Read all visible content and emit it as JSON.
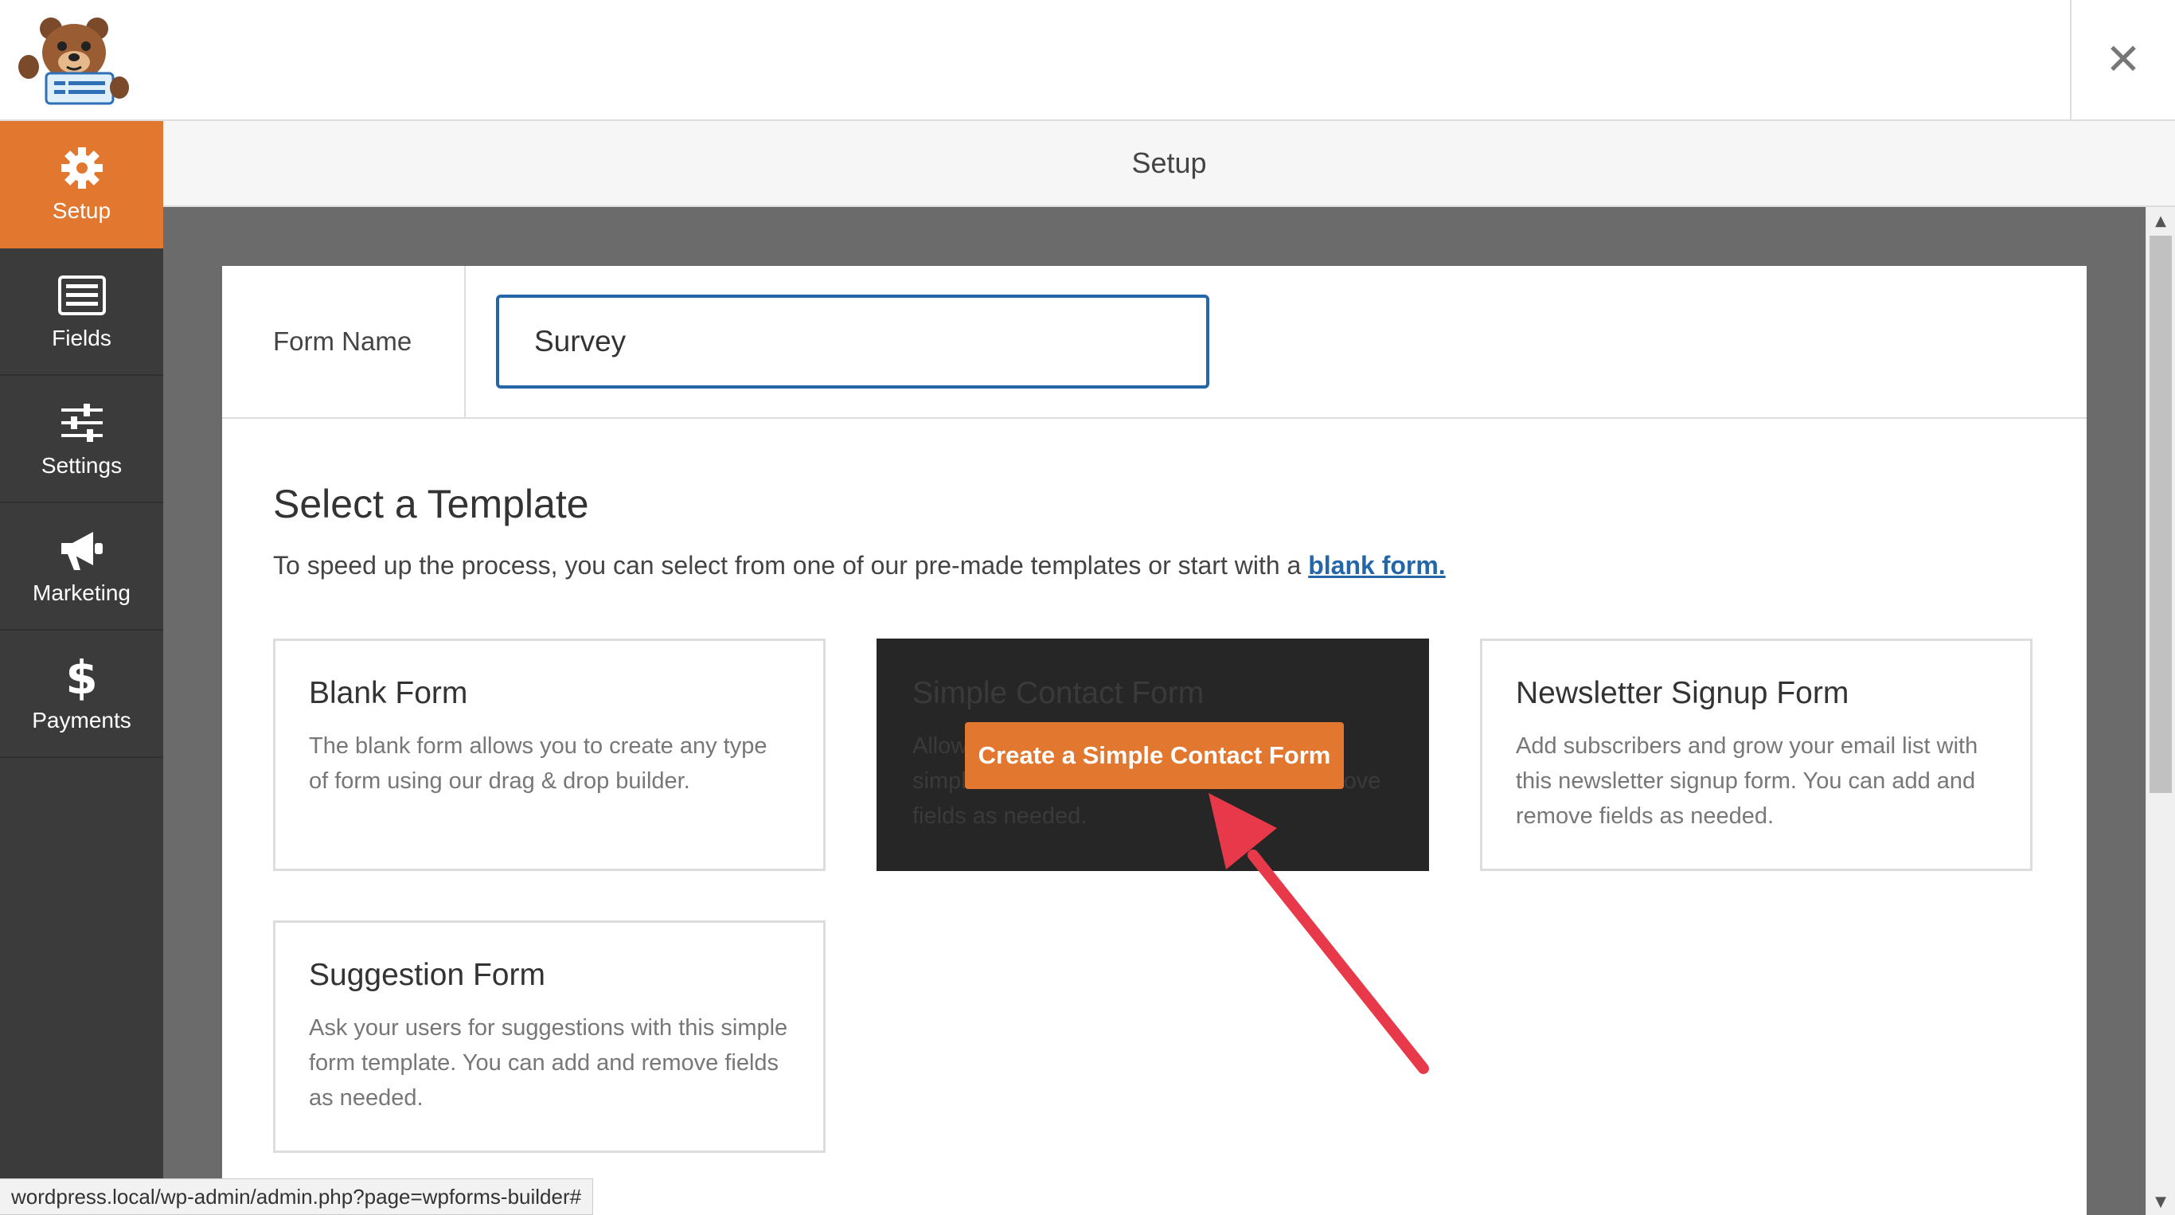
{
  "app": {
    "logo_name": "wpforms-bear-logo",
    "close_label": "✕"
  },
  "sidebar": {
    "items": [
      {
        "label": "Setup",
        "icon": "gear-icon",
        "active": true
      },
      {
        "label": "Fields",
        "icon": "list-icon",
        "active": false
      },
      {
        "label": "Settings",
        "icon": "sliders-icon",
        "active": false
      },
      {
        "label": "Marketing",
        "icon": "megaphone-icon",
        "active": false
      },
      {
        "label": "Payments",
        "icon": "dollar-icon",
        "active": false
      }
    ]
  },
  "header": {
    "title": "Setup"
  },
  "form_name": {
    "label": "Form Name",
    "value": "Survey"
  },
  "templates": {
    "title": "Select a Template",
    "description": "To speed up the process, you can select from one of our pre-made templates or start with a ",
    "blank_link": "blank form.",
    "cards": [
      {
        "title": "Blank Form",
        "desc": "The blank form allows you to create any type of form using our drag & drop builder."
      },
      {
        "title": "Simple Contact Form",
        "desc": "Allow your users to contact you with this simple contact form. You can add and remove fields as needed.",
        "button": "Create a Simple Contact Form"
      },
      {
        "title": "Newsletter Signup Form",
        "desc": "Add subscribers and grow your email list with this newsletter signup form. You can add and remove fields as needed."
      },
      {
        "title": "Suggestion Form",
        "desc": "Ask your users for suggestions with this simple form template. You can add and remove fields as needed."
      }
    ]
  },
  "status_bar": {
    "url": "wordpress.local/wp-admin/admin.php?page=wpforms-builder#"
  },
  "colors": {
    "accent": "#e27730",
    "sidebar": "#3b3b3b",
    "link": "#2466a8",
    "annotation_arrow": "#e8394a"
  }
}
